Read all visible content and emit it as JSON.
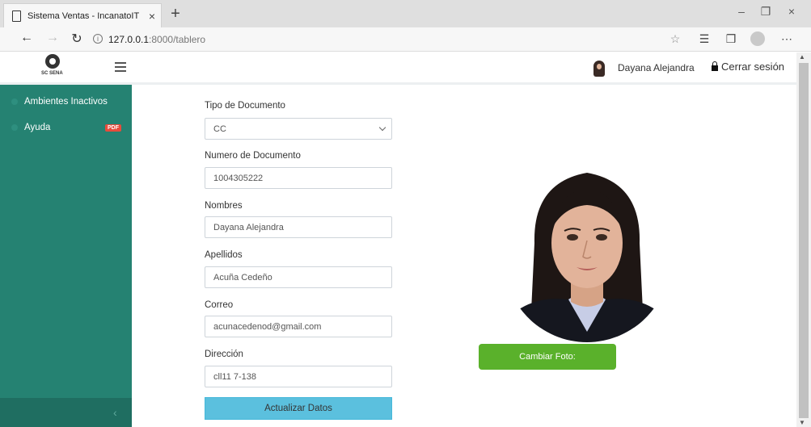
{
  "browser": {
    "tab_title": "Sistema Ventas - IncanatoIT",
    "tab_close": "×",
    "new_tab": "+",
    "url_host": "127.0.0.1",
    "url_path": ":8000/tablero",
    "info_glyph": "i",
    "window_controls": [
      "–",
      "❐",
      "×"
    ]
  },
  "header": {
    "logo_text": "SC SENA",
    "user_name": "Dayana Alejandra",
    "logout_label": "Cerrar sesión"
  },
  "sidebar": {
    "items": [
      {
        "label": "Ambientes Inactivos"
      },
      {
        "label": "Ayuda",
        "badge": "PDF"
      }
    ],
    "collapse_glyph": "‹"
  },
  "form": {
    "tipo_label": "Tipo de Documento",
    "tipo_value": "CC",
    "numero_label": "Numero de Documento",
    "numero_value": "1004305222",
    "nombres_label": "Nombres",
    "nombres_value": "Dayana Alejandra",
    "apellidos_label": "Apellidos",
    "apellidos_value": "Acuña Cedeño",
    "correo_label": "Correo",
    "correo_value": "acunacedenod@gmail.com",
    "direccion_label": "Dirección",
    "direccion_value": "cll11 7-138",
    "update_label": "Actualizar Datos"
  },
  "photo": {
    "change_label": "Cambiar Foto:"
  },
  "colors": {
    "sidebar": "#258272",
    "update_button": "#5bc0de",
    "change_photo_button": "#5ab12b",
    "pdf_badge": "#e74c3c"
  }
}
